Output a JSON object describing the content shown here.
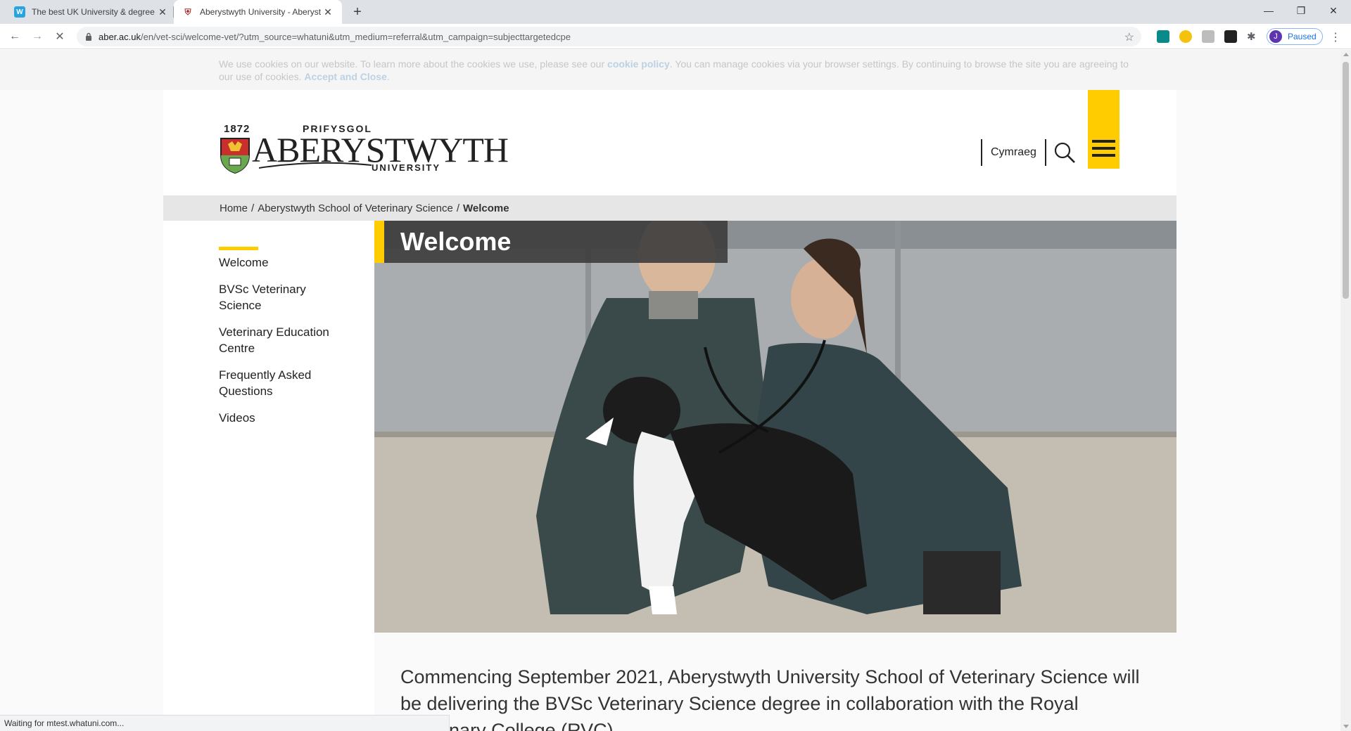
{
  "browser": {
    "tabs": [
      {
        "title": "The best UK University & degree"
      },
      {
        "title": "Aberystwyth University - Aberyst"
      }
    ],
    "url_host": "aber.ac.uk",
    "url_path": "/en/vet-sci/welcome-vet/?utm_source=whatuni&utm_medium=referral&utm_campaign=subjecttargetedcpe",
    "profile": {
      "initial": "J",
      "label": "Paused"
    },
    "status": "Waiting for mtest.whatuni.com..."
  },
  "cookie": {
    "text_1": "We use cookies on our website. To learn more about the cookies we use, please see our ",
    "link_policy": "cookie policy",
    "text_2": ". You can manage cookies via your browser settings. By continuing to browse the site you are agreeing to our use of cookies. ",
    "link_accept": "Accept and Close",
    "text_3": "."
  },
  "header": {
    "logo": {
      "year": "1872",
      "line1": "PRIFYSGOL",
      "line2": "ABERYSTWYTH",
      "line3": "UNIVERSITY"
    },
    "language_link": "Cymraeg"
  },
  "breadcrumb": {
    "home": "Home",
    "school": "Aberystwyth School of Veterinary Science",
    "current": "Welcome"
  },
  "sidenav": {
    "items": [
      {
        "label": "Welcome"
      },
      {
        "label": "BVSc Veterinary Science"
      },
      {
        "label": "Veterinary Education Centre"
      },
      {
        "label": "Frequently Asked Questions"
      },
      {
        "label": "Videos"
      }
    ]
  },
  "hero": {
    "heading": "Welcome"
  },
  "content": {
    "intro": "Commencing September 2021, Aberystwyth University School of Veterinary Science will be delivering the BVSc Veterinary Science degree in collaboration with the Royal Veterinary College (RVC)."
  },
  "colors": {
    "accent": "#ffcc00",
    "dark": "#222222"
  }
}
